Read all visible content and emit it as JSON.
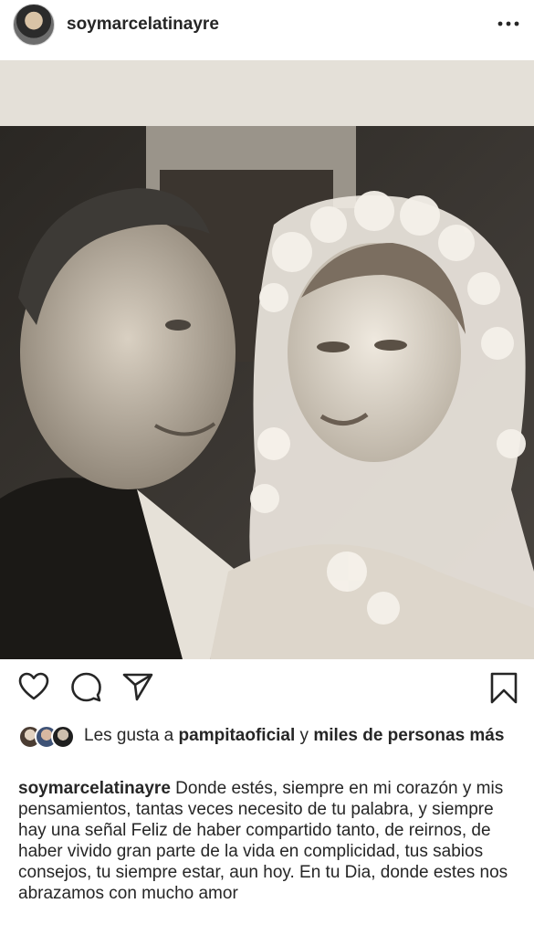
{
  "post": {
    "username": "soymarcelatinayre",
    "more_icon": "more-horizontal-icon"
  },
  "actions": {
    "like_icon": "heart-icon",
    "comment_icon": "comment-icon",
    "share_icon": "share-icon",
    "save_icon": "bookmark-icon"
  },
  "likes": {
    "prefix": "Les gusta a ",
    "user": "pampitaoficial",
    "connector": " y ",
    "others": "miles de personas más"
  },
  "caption": {
    "username": "soymarcelatinayre",
    "text": "Donde estés, siempre en mi corazón y mis pensamientos, tantas veces necesito de tu palabra, y siempre hay una señal Feliz de haber compartido tanto, de reirnos, de haber vivido gran parte de la vida en complicidad, tus sabios consejos, tu siempre estar, aun hoy. En tu Dia, donde estes nos abrazamos con mucho amor"
  },
  "colors": {
    "text": "#262626",
    "background": "#ffffff"
  }
}
